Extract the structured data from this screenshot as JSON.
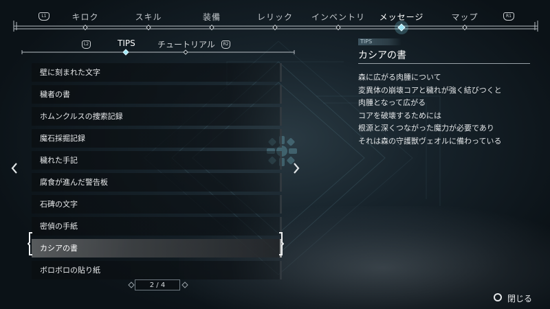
{
  "top_nav": {
    "left_button": "L1",
    "right_button": "R1",
    "tabs": [
      {
        "label": "キロク"
      },
      {
        "label": "スキル"
      },
      {
        "label": "装備"
      },
      {
        "label": "レリック"
      },
      {
        "label": "インベントリ"
      },
      {
        "label": "メッセージ"
      },
      {
        "label": "マップ"
      }
    ],
    "active_tab": "メッセージ"
  },
  "sub_tabs": {
    "left_button": "L2",
    "right_button": "R2",
    "tabs": [
      {
        "label": "TIPS"
      },
      {
        "label": "チュートリアル"
      }
    ],
    "active_tab": "TIPS"
  },
  "tips_list": {
    "items": [
      {
        "label": "壁に刻まれた文字"
      },
      {
        "label": "穢者の書"
      },
      {
        "label": "ホムンクルスの捜索記録"
      },
      {
        "label": "魔石採掘記録"
      },
      {
        "label": "穢れた手記"
      },
      {
        "label": "腐食が進んだ警告板"
      },
      {
        "label": "石碑の文字"
      },
      {
        "label": "密偵の手紙"
      },
      {
        "label": "カシアの書"
      },
      {
        "label": "ボロボロの貼り紙"
      }
    ],
    "selected": "カシアの書"
  },
  "pager": {
    "text": "2 / 4"
  },
  "detail": {
    "category": "TIPS",
    "title": "カシアの書",
    "lines": [
      "森に広がる肉腫について",
      "変異体の崩壊コアと穢れが強く結びつくと",
      "肉腫となって広がる",
      "コアを破壊するためには",
      "根源と深くつながった魔力が必要であり",
      "それは森の守護獣ヴェオルに備わっている"
    ]
  },
  "close_hint": {
    "label": "閉じる",
    "icon": "circle-button-icon"
  },
  "colors": {
    "accent": "#7fd3e6",
    "background": "#17232b"
  }
}
